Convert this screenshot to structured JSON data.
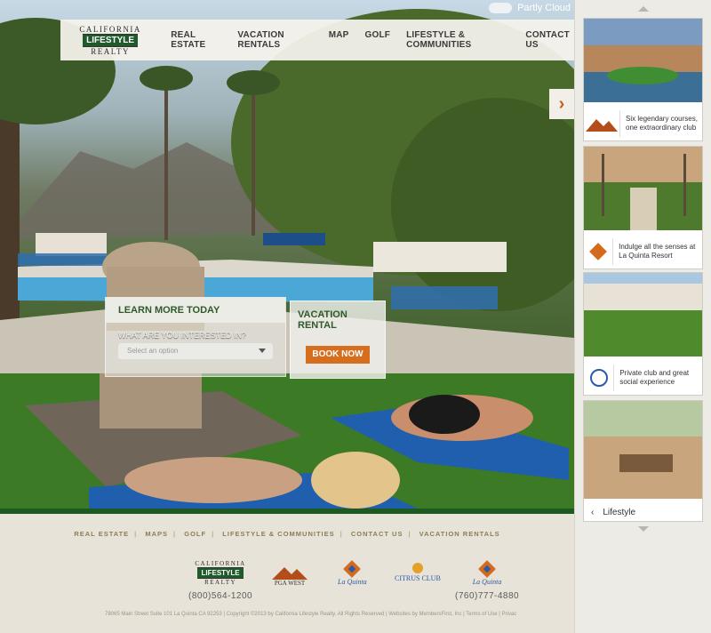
{
  "weather": {
    "condition": "Partly Cloud"
  },
  "logo": {
    "line1": "CALIFORNIA",
    "line2": "LIFESTYLE",
    "line3": "REALTY"
  },
  "nav": [
    "REAL ESTATE",
    "VACATION RENTALS",
    "MAP",
    "GOLF",
    "LIFESTYLE & COMMUNITIES",
    "CONTACT US"
  ],
  "learn_more": {
    "title": "LEARN MORE TODAY",
    "question": "WHAT ARE YOU INTERESTED IN?",
    "placeholder": "Select an option"
  },
  "vacation": {
    "title": "VACATION RENTAL",
    "button": "BOOK NOW"
  },
  "footer": {
    "nav": [
      "REAL ESTATE",
      "MAPS",
      "GOLF",
      "LIFESTYLE & COMMUNITIES",
      "CONTACT US",
      "VACATION RENTALS"
    ],
    "logos": {
      "california": {
        "line1": "CALIFORNIA",
        "line2": "LIFESTYLE",
        "line3": "REALTY"
      },
      "pga": "PGA WEST",
      "laquinta": "La Quinta",
      "citrus": "CITRUS CLUB",
      "laquinta2": "La Quinta"
    },
    "phone_left": "(800)564-1200",
    "phone_right": "(760)777-4880",
    "fine": "78065 Main Street Suite 101 La Quinta CA 92253   |   Copyright ©2013 by California Lifestyle Realty. All Rights Reserved   |   Websites by MembersFirst, Inc   |   Terms of Use   |   Privac"
  },
  "sidebar": {
    "cards": [
      {
        "brand": "PGA WEST",
        "text": "Six legendary courses, one extraordinary club"
      },
      {
        "brand": "La Quinta",
        "text": "Indulge all the senses at La Quinta Resort"
      },
      {
        "brand": "CITRUS CLUB",
        "text": "Private club and great social experience"
      }
    ],
    "lifestyle": "Lifestyle",
    "lifestyle_prev": "‹"
  },
  "colors": {
    "brand_green": "#1f5a2a",
    "accent_orange": "#d56f1e",
    "nav_arrow": "#c45e1d"
  }
}
